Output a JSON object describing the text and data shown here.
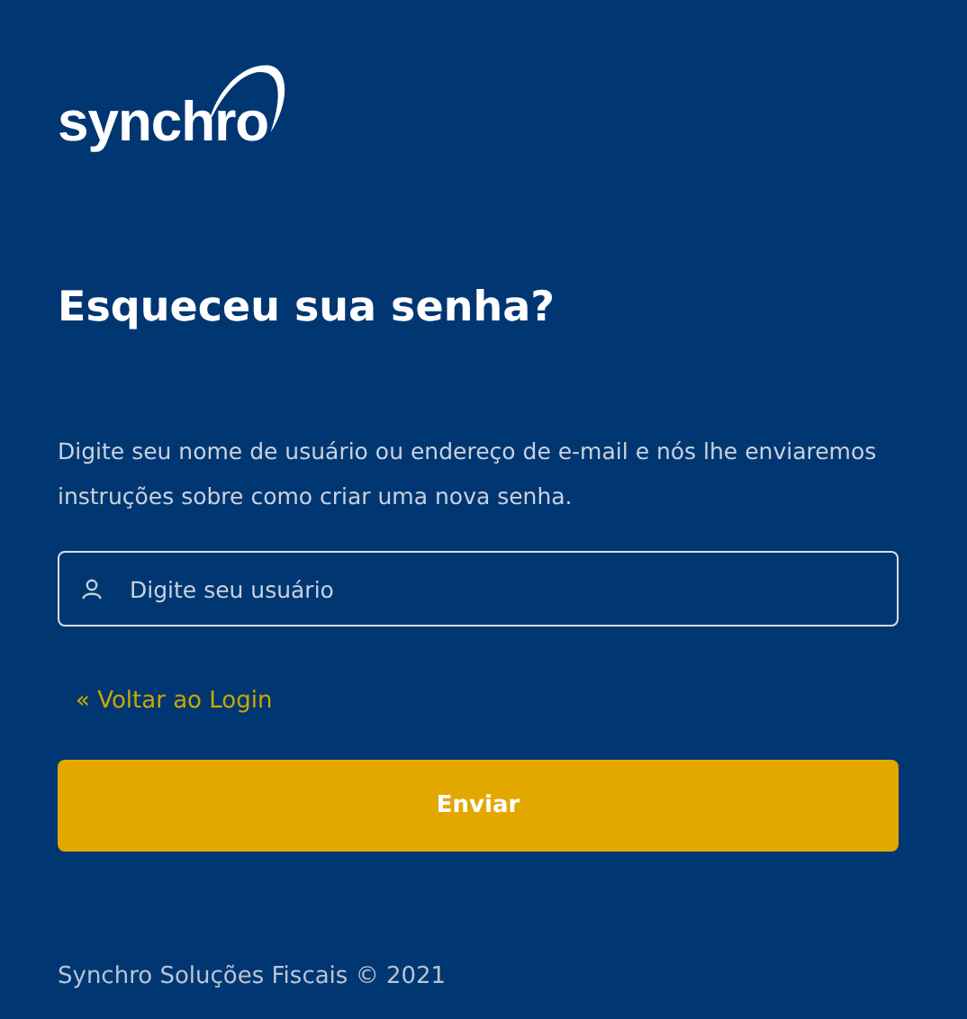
{
  "logo": {
    "text": "synchro"
  },
  "title": "Esqueceu sua senha?",
  "instructions": "Digite seu nome de usuário ou endereço de e-mail e nós lhe enviaremos instruções sobre como criar uma nova senha.",
  "username_field": {
    "placeholder": "Digite seu usuário"
  },
  "back_link": "« Voltar ao Login",
  "submit_button": "Enviar",
  "footer": "Synchro Soluções Fiscais © 2021"
}
